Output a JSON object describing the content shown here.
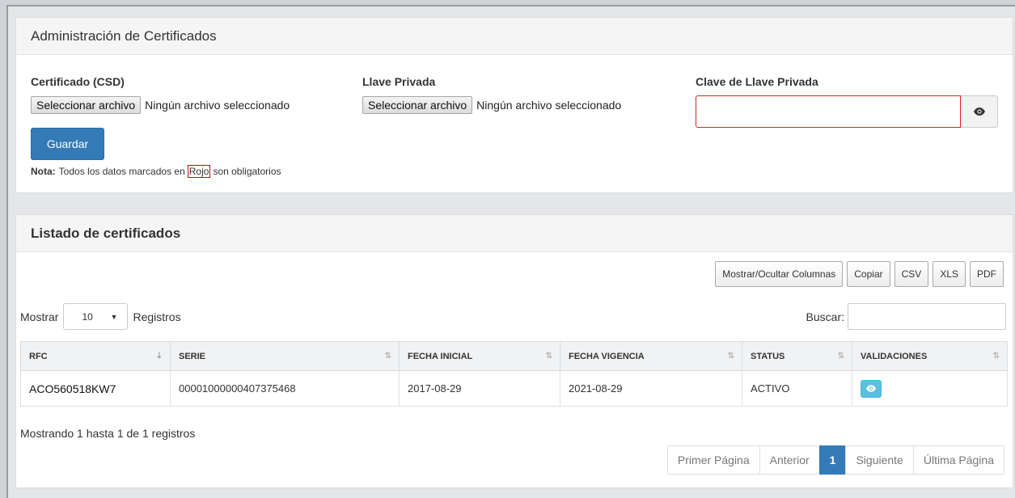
{
  "certificates_panel": {
    "title": "Administración de Certificados",
    "certificado": {
      "label": "Certificado (CSD)",
      "button": "Seleccionar archivo",
      "status": "Ningún archivo seleccionado"
    },
    "llave": {
      "label": "Llave Privada",
      "button": "Seleccionar archivo",
      "status": "Ningún archivo seleccionado"
    },
    "clave": {
      "label": "Clave de Llave Privada",
      "value": ""
    },
    "save_label": "Guardar",
    "note_prefix": "Nota:",
    "note_text_before": "Todos los datos marcados en",
    "note_highlight": "Rojo",
    "note_text_after": "son obligatorios"
  },
  "list_panel": {
    "title": "Listado de certificados",
    "export_buttons": [
      "Mostrar/Ocultar Columnas",
      "Copiar",
      "CSV",
      "XLS",
      "PDF"
    ],
    "length": {
      "prefix": "Mostrar",
      "value": "10",
      "suffix": "Registros"
    },
    "search": {
      "label": "Buscar:",
      "value": ""
    },
    "columns": [
      "RFC",
      "SERIE",
      "FECHA INICIAL",
      "FECHA VIGENCIA",
      "STATUS",
      "VALIDACIONES"
    ],
    "rows": [
      {
        "rfc": "ACO560518KW7",
        "serie": "00001000000407375468",
        "fecha_inicial": "2017-08-29",
        "fecha_vigencia": "2021-08-29",
        "status": "ACTIVO"
      }
    ],
    "info": "Mostrando 1 hasta 1 de 1 registros",
    "pagination": [
      "Primer Página",
      "Anterior",
      "1",
      "Siguiente",
      "Última Página"
    ],
    "active_page": "1"
  },
  "colors": {
    "primary": "#337ab7",
    "info": "#5bc0de",
    "required_border": "#e02020"
  },
  "icons": {
    "show_password": "eye-icon",
    "validate": "eye-icon",
    "sort": "sort-icon"
  }
}
